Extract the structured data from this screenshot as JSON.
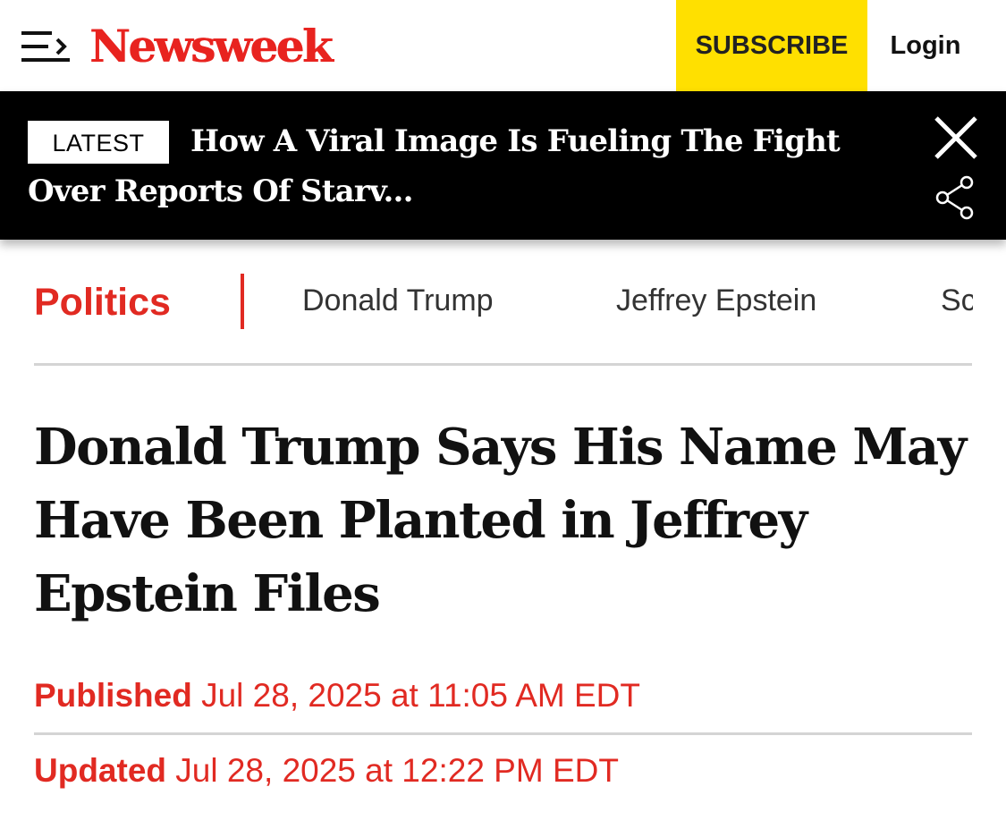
{
  "header": {
    "logo": "Newsweek",
    "subscribe_label": "SUBSCRIBE",
    "login_label": "Login",
    "brand_color": "#e8231f",
    "subscribe_color": "#ffe000",
    "menu_icon": "menu-icon"
  },
  "banner": {
    "badge": "LATEST",
    "headline": "How A Viral Image Is Fueling The Fight Over Reports Of Starv...",
    "close_icon": "close-icon",
    "share_icon": "share-icon"
  },
  "nav": {
    "section": "Politics",
    "items": [
      "Donald Trump",
      "Jeffrey Epstein",
      "Sc"
    ]
  },
  "article": {
    "title": "Donald Trump Says His Name May Have Been Planted in Jeffrey Epstein Files",
    "published_label": "Published",
    "published_value": "Jul 28, 2025 at 11:05 AM EDT",
    "updated_label": "Updated",
    "updated_value": "Jul 28, 2025 at 12:22 PM EDT",
    "accent_color": "#e12a22"
  }
}
